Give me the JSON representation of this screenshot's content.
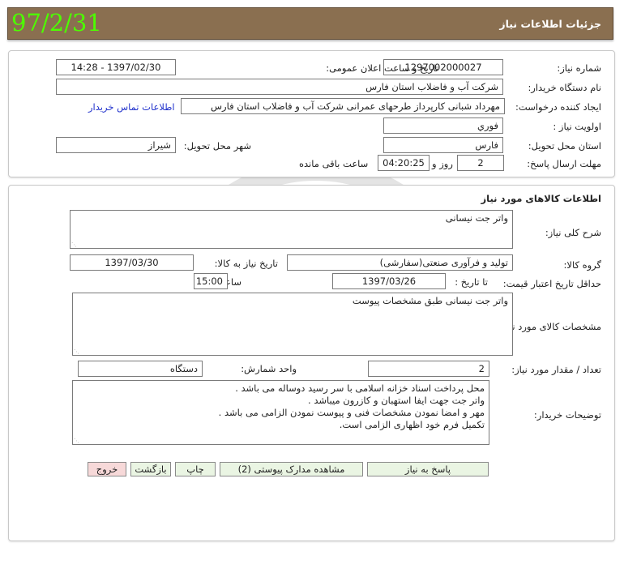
{
  "header": {
    "title": "جزئیات اطلاعات نیاز",
    "date_stamp": "97/2/31"
  },
  "details": {
    "need_number_label": "شماره نیاز:",
    "need_number": "1297002000027",
    "announce_label": "تاریخ و ساعت اعلان عمومی:",
    "announce_value": "1397/02/30 - 14:28",
    "buyer_org_label": "نام دستگاه خریدار:",
    "buyer_org": "شرکت آب و فاضلاب استان فارس",
    "requester_label": "ایجاد کننده درخواست:",
    "requester": "مهرداد شبانی کارپرداز طرحهای عمرانی  شرکت آب و فاضلاب استان فارس",
    "contact_link": "اطلاعات تماس خریدار",
    "priority_label": "اولویت نیاز :",
    "priority": "فوري",
    "province_label": "استان محل تحویل:",
    "province": "فارس",
    "city_label": "شهر محل تحویل:",
    "city": "شیراز",
    "deadline_label": "مهلت ارسال پاسخ:",
    "days_value": "2",
    "days_and_label": "روز و",
    "time_remaining": "04:20:25",
    "time_remaining_label": "ساعت باقی مانده"
  },
  "goods": {
    "section_title": "اطلاعات کالاهای مورد نیاز",
    "description_label": "شرح کلی نیاز:",
    "description": "واتر جت نیسانی",
    "group_label": "گروه کالا:",
    "group": "تولید و فرآوری صنعتی(سفارشی)",
    "need_date_label": "تاریخ نیاز به کالا:",
    "need_date": "1397/03/30",
    "price_validity_label": "حداقل تاریخ اعتبار قیمت:",
    "until_date_label": "تا تاریخ :",
    "until_date": "1397/03/26",
    "hour_label": "ساعت :",
    "hour": "15:00",
    "specs_label": "مشخصات کالای مورد نیاز:",
    "specs": "واتر جت نیسانی طبق مشخصات پیوست",
    "quantity_label": "تعداد / مقدار مورد نیاز:",
    "quantity": "2",
    "unit_label": "واحد شمارش:",
    "unit": "دستگاه",
    "buyer_notes_label": "توضیحات خریدار:",
    "buyer_notes": [
      "محل پرداخت اسناد خزانه اسلامی با سر رسید دوساله می باشد .",
      "واتر جت جهت ایفا استهبان و کازرون میباشد .",
      "مهر و امضا نمودن مشخصات فنی و پیوست نمودن الزامی می باشد .",
      "تکمیل فرم خود اظهاری الزامی است."
    ]
  },
  "actions": {
    "reply": "پاسخ به نیاز",
    "attachments": "مشاهده مدارک پیوستی (2)",
    "print": "چاپ",
    "back": "بازگشت",
    "exit": "خروج"
  },
  "colors": {
    "header_bg": "#8a6f50",
    "date_stamp": "#4cff00",
    "button_bg": "#eaf5e3",
    "exit_button_bg": "#f7d9d9",
    "link": "#2233cc"
  }
}
